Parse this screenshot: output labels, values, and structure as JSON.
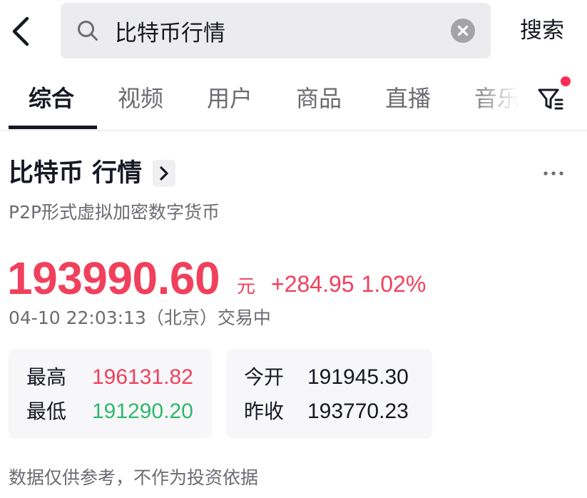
{
  "search": {
    "query": "比特币行情",
    "submit_label": "搜索",
    "back_icon": "chevron-left-icon",
    "search_icon": "magnifier-icon",
    "clear_icon": "close-circle-icon"
  },
  "tabs": [
    {
      "label": "综合",
      "active": true
    },
    {
      "label": "视频",
      "active": false
    },
    {
      "label": "用户",
      "active": false
    },
    {
      "label": "商品",
      "active": false
    },
    {
      "label": "直播",
      "active": false
    },
    {
      "label": "音乐",
      "active": false
    }
  ],
  "filter": {
    "icon": "filter-icon",
    "has_badge": true
  },
  "card": {
    "title": "比特币 行情",
    "subtitle": "P2P形式虚拟加密数字货币",
    "price": "193990.60",
    "unit": "元",
    "change": "+284.95",
    "change_pct": "1.02%",
    "timestamp": "04-10 22:03:13（北京）交易中",
    "stats": {
      "high_label": "最高",
      "high": "196131.82",
      "low_label": "最低",
      "low": "191290.20",
      "open_label": "今开",
      "open": "191945.30",
      "prev_close_label": "昨收",
      "prev_close": "193770.23"
    },
    "disclaimer": "数据仅供参考，不作为投资依据"
  },
  "colors": {
    "up": "#f0405c",
    "down": "#2fb86e",
    "text": "#161823",
    "muted": "#6b6b70",
    "badge": "#fe2c55"
  }
}
